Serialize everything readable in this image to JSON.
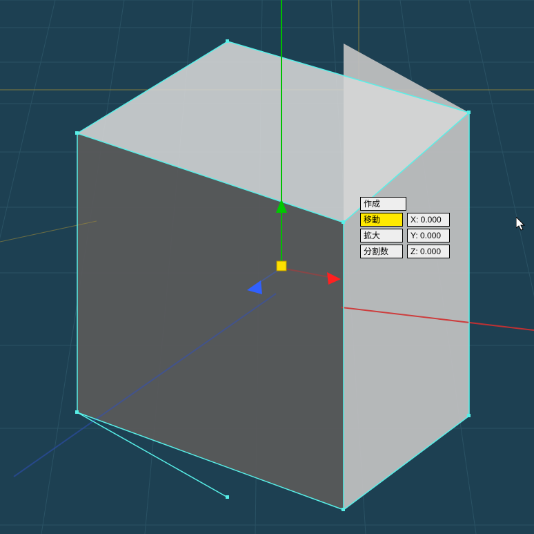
{
  "panel": {
    "create_label": "作成",
    "move_label": "移動",
    "scale_label": "拡大",
    "subdiv_label": "分割数",
    "x_value": "X: 0.000",
    "y_value": "Y: 0.000",
    "z_value": "Z: 0.000"
  },
  "colors": {
    "bg": "#1d4052",
    "grid_minor": "#2c5466",
    "grid_axis_yellow": "#b0a050",
    "gizmo_green": "#00e000",
    "gizmo_red": "#ff1010",
    "gizmo_blue": "#3060ff",
    "gizmo_yellow": "#ffe000",
    "selection": "#58f0e8",
    "cube_light": "#d5d5d5",
    "cube_mid": "#a0a0a0",
    "cube_dark": "#5a5a5a"
  },
  "gizmo": {
    "origin": "viewport-center",
    "axes": [
      "x",
      "y",
      "z"
    ]
  },
  "selection": {
    "object": "cube",
    "selected": true
  }
}
